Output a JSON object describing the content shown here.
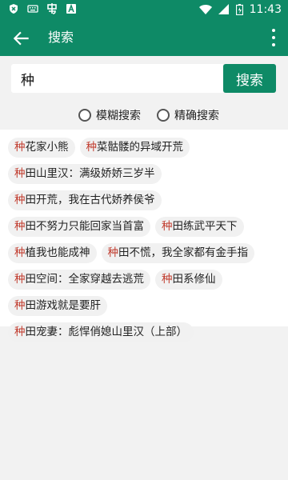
{
  "status_bar": {
    "time": "11:43",
    "left_icons": [
      "shield-icon",
      "keyboard-icon",
      "chinese-char-icon",
      "font-a-icon"
    ],
    "right_icons": [
      "wifi-icon",
      "signal-icon",
      "battery-icon"
    ]
  },
  "app_bar": {
    "title": "搜索",
    "back_icon": "arrow-left-icon",
    "more_icon": "more-vertical-icon",
    "color": "#0e8a66"
  },
  "search": {
    "value": "种",
    "button_label": "搜索"
  },
  "mode": {
    "fuzzy_label": "模糊搜索",
    "exact_label": "精确搜索"
  },
  "results": {
    "highlight": "种",
    "highlight_color": "#c0392b",
    "items": [
      {
        "prefix": "种",
        "rest": "花家小熊"
      },
      {
        "prefix": "种",
        "rest": "菜骷髅的异域开荒"
      },
      {
        "prefix": "种",
        "rest": "田山里汉：满级娇娇三岁半"
      },
      {
        "prefix": "种",
        "rest": "田开荒，我在古代娇养侯爷"
      },
      {
        "prefix": "种",
        "rest": "田不努力只能回家当首富"
      },
      {
        "prefix": "种",
        "rest": "田练武平天下"
      },
      {
        "prefix": "种",
        "rest": "植我也能成神"
      },
      {
        "prefix": "种",
        "rest": "田不慌，我全家都有金手指"
      },
      {
        "prefix": "种",
        "rest": "田空间：全家穿越去逃荒"
      },
      {
        "prefix": "种",
        "rest": "田系修仙"
      },
      {
        "prefix": "种",
        "rest": "田游戏就是要肝"
      },
      {
        "prefix": "种",
        "rest": "田宠妻：彪悍俏媳山里汉（上部）"
      }
    ]
  }
}
